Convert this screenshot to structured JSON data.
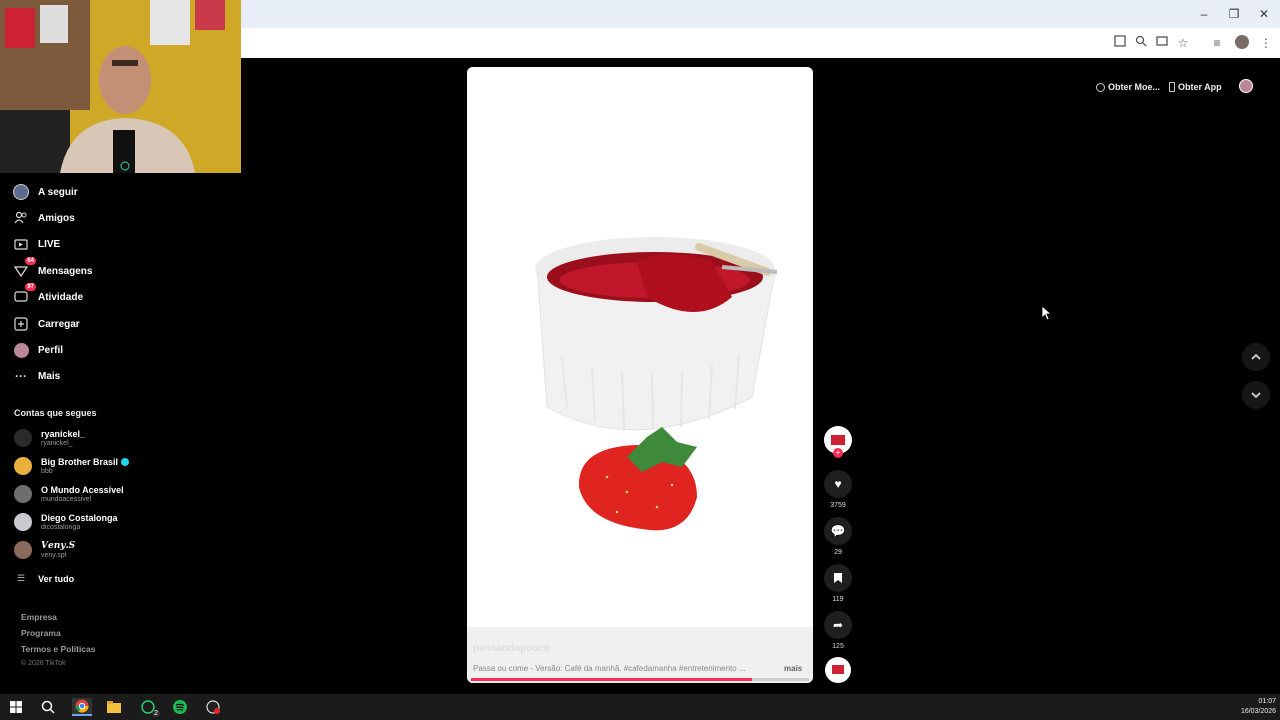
{
  "browser": {
    "minimize": "–",
    "restore": "❐",
    "close": "✕"
  },
  "sidebar": {
    "items": [
      {
        "label": "A seguir",
        "icon": "following-avatar-icon"
      },
      {
        "label": "Amigos",
        "icon": "friends-icon"
      },
      {
        "label": "LIVE",
        "icon": "live-icon"
      },
      {
        "label": "Mensagens",
        "icon": "messages-icon",
        "badge": "64"
      },
      {
        "label": "Atividade",
        "icon": "activity-icon",
        "badge": "97"
      },
      {
        "label": "Carregar",
        "icon": "upload-icon"
      },
      {
        "label": "Perfil",
        "icon": "profile-avatar-icon"
      },
      {
        "label": "Mais",
        "icon": "more-icon"
      }
    ],
    "following_title": "Contas que segues",
    "accounts": [
      {
        "name": "ryanickel_",
        "handle": "ryanickel_",
        "verified": false
      },
      {
        "name": "Big Brother Brasil",
        "handle": "bbb",
        "verified": true
      },
      {
        "name": "O Mundo Acessível",
        "handle": "mundoacessivel",
        "verified": false
      },
      {
        "name": "Diego Costalonga",
        "handle": "dicostalonga",
        "verified": false
      },
      {
        "name": "𝑽𝒆𝒏𝒚.𝑺",
        "handle": "veny.spt",
        "verified": false
      }
    ],
    "see_all": "Ver tudo",
    "footer": {
      "company": "Empresa",
      "program": "Programa",
      "terms": "Termos e Políticas",
      "copyright": "© 2026 TikTok"
    }
  },
  "header": {
    "coins": "Obter Moe...",
    "get_app": "Obter App"
  },
  "video": {
    "author": "pensandopouco",
    "caption": "Passa ou come - Versão: Café da manhã. #cafedamanha #entretenimento ...",
    "more": "mais",
    "progress": 0.83
  },
  "actions": {
    "likes": "3759",
    "comments": "29",
    "saves": "119",
    "shares": "125"
  },
  "taskbar": {
    "time": "01:07",
    "date": "16/03/2026",
    "whatsapp_badge": "2"
  },
  "colors": {
    "accent": "#fe2c55",
    "jam": "#b0101e"
  }
}
